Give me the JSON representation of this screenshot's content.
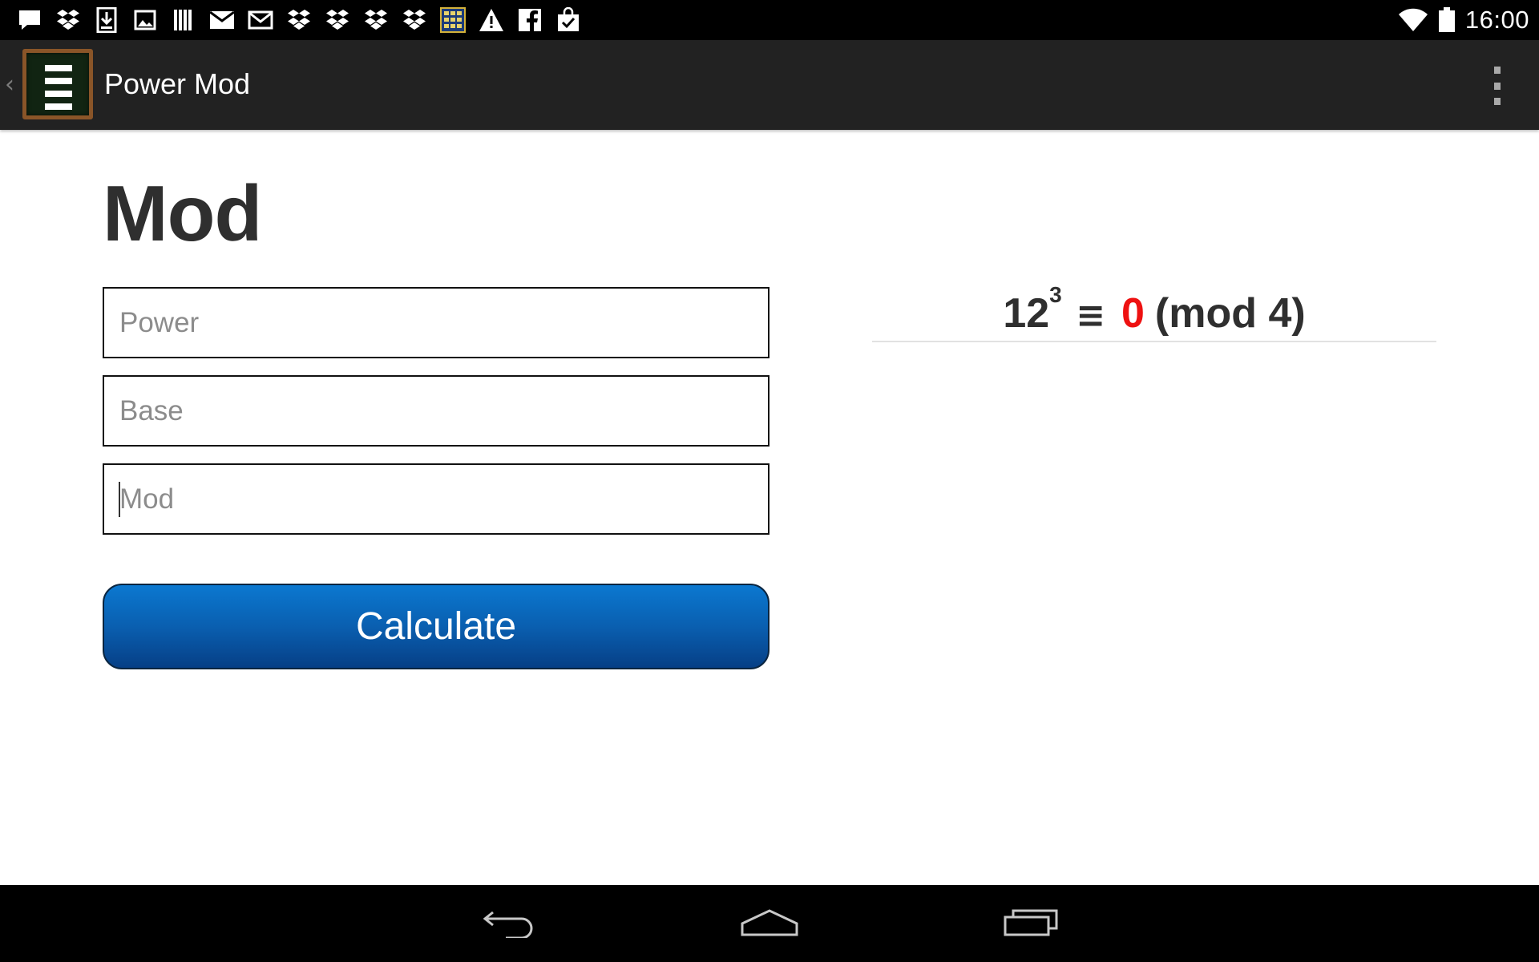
{
  "status_bar": {
    "time": "16:00",
    "notification_icons": [
      "chat-bubble-icon",
      "dropbox-icon",
      "download-icon",
      "image-icon",
      "library-icon",
      "mail-icon",
      "gmail-icon",
      "dropbox-icon",
      "dropbox-icon",
      "dropbox-icon",
      "dropbox-icon",
      "app-grid-icon",
      "warning-icon",
      "facebook-icon",
      "shopping-bag-icon"
    ],
    "system_icons": [
      "wifi-icon",
      "battery-icon"
    ]
  },
  "action_bar": {
    "title": "Power Mod",
    "up_caret": "‹"
  },
  "form": {
    "heading": "Mod",
    "power": {
      "placeholder": "Power",
      "value": ""
    },
    "base": {
      "placeholder": "Base",
      "value": ""
    },
    "mod": {
      "placeholder": "Mod",
      "value": ""
    },
    "calculate_label": "Calculate"
  },
  "result": {
    "base": "12",
    "exponent": "3",
    "congruence_symbol": "≡",
    "remainder": "0",
    "modulus_text": "(mod 4)"
  },
  "colors": {
    "status_bar_bg": "#000000",
    "action_bar_bg": "#222222",
    "button_top": "#0b78d0",
    "button_bottom": "#063f86",
    "remainder": "#ee1111",
    "heading_text": "#2f2f2f"
  }
}
